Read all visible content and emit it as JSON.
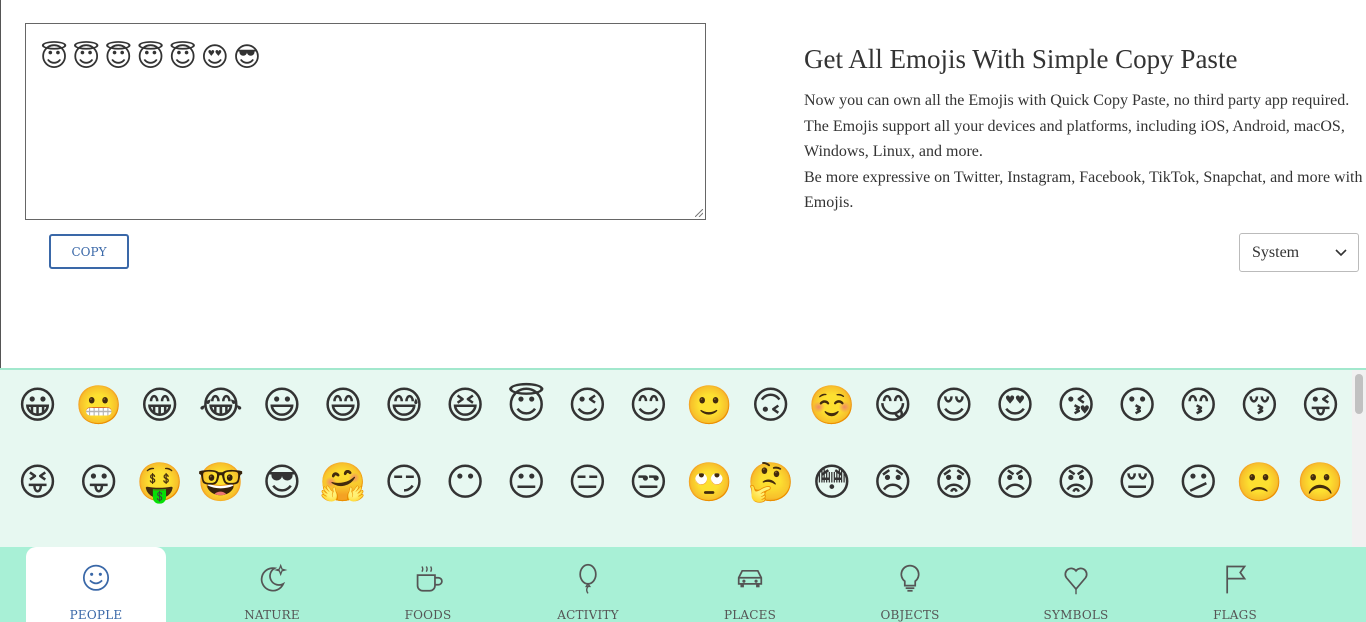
{
  "editor": {
    "content": "😇😇😇😇😇😍😎",
    "copy_label": "COPY"
  },
  "hero": {
    "title": "Get All Emojis With Simple Copy Paste",
    "paragraph1": "Now you can own all the Emojis with Quick Copy Paste, no third party app required. The Emojis support all your devices and platforms, including iOS, Android, macOS, Windows, Linux, and more.",
    "paragraph2": "Be more expressive on Twitter, Instagram, Facebook, TikTok, Snapchat, and more with Emojis."
  },
  "platform_select": {
    "value": "System"
  },
  "emojis": [
    "😀",
    "😬",
    "😁",
    "😂",
    "😃",
    "😄",
    "😅",
    "😆",
    "😇",
    "😉",
    "😊",
    "🙂",
    "🙃",
    "☺️",
    "😋",
    "😌",
    "😍",
    "😘",
    "😗",
    "😙",
    "😚",
    "😜",
    "😝",
    "😛",
    "🤑",
    "🤓",
    "😎",
    "🤗",
    "😏",
    "😶",
    "😐",
    "😑",
    "😒",
    "🙄",
    "🤔",
    "😳",
    "😞",
    "😟",
    "😠",
    "😡",
    "😔",
    "😕",
    "🙁",
    "☹️"
  ],
  "nav": [
    {
      "label": "PEOPLE",
      "icon": "smiley-icon",
      "active": true
    },
    {
      "label": "NATURE",
      "icon": "moon-stars-icon"
    },
    {
      "label": "FOODS",
      "icon": "coffee-cup-icon"
    },
    {
      "label": "ACTIVITY",
      "icon": "balloon-icon"
    },
    {
      "label": "PLACES",
      "icon": "car-icon"
    },
    {
      "label": "OBJECTS",
      "icon": "lightbulb-icon"
    },
    {
      "label": "SYMBOLS",
      "icon": "heart-icon"
    },
    {
      "label": "FLAGS",
      "icon": "flag-icon"
    }
  ],
  "colors": {
    "accent": "#3a68a8",
    "panel_bg": "#e7f8f1",
    "nav_bg": "#a8f0d6"
  }
}
